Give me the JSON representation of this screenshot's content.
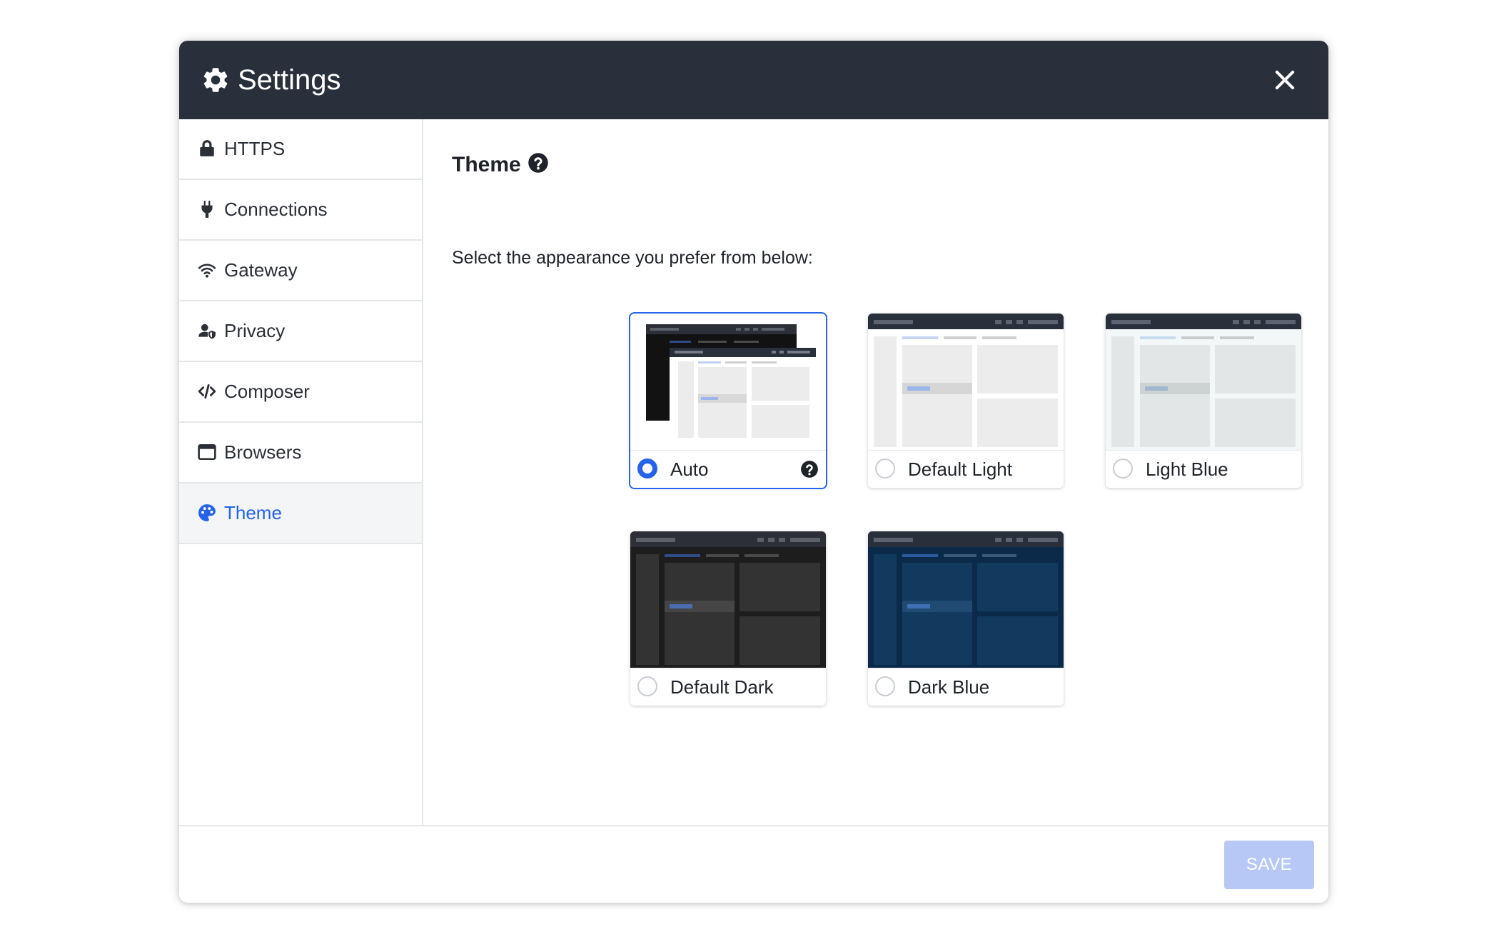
{
  "dialog": {
    "title": "Settings",
    "header_bg": "#2a2f3c",
    "accent": "#2563eb"
  },
  "sidebar": {
    "items": [
      {
        "label": "HTTPS",
        "icon": "lock-icon"
      },
      {
        "label": "Connections",
        "icon": "plug-icon"
      },
      {
        "label": "Gateway",
        "icon": "wifi-icon"
      },
      {
        "label": "Privacy",
        "icon": "user-shield-icon"
      },
      {
        "label": "Composer",
        "icon": "code-icon"
      },
      {
        "label": "Browsers",
        "icon": "browser-window-icon"
      },
      {
        "label": "Theme",
        "icon": "palette-icon",
        "active": true
      }
    ]
  },
  "theme": {
    "title": "Theme",
    "description": "Select the appearance you prefer from below:",
    "options": [
      {
        "name": "Auto",
        "selected": true
      },
      {
        "name": "Default Light",
        "selected": false
      },
      {
        "name": "Light Blue",
        "selected": false
      },
      {
        "name": "Default Dark",
        "selected": false
      },
      {
        "name": "Dark Blue",
        "selected": false
      }
    ]
  },
  "footer": {
    "save_label": "SAVE"
  }
}
